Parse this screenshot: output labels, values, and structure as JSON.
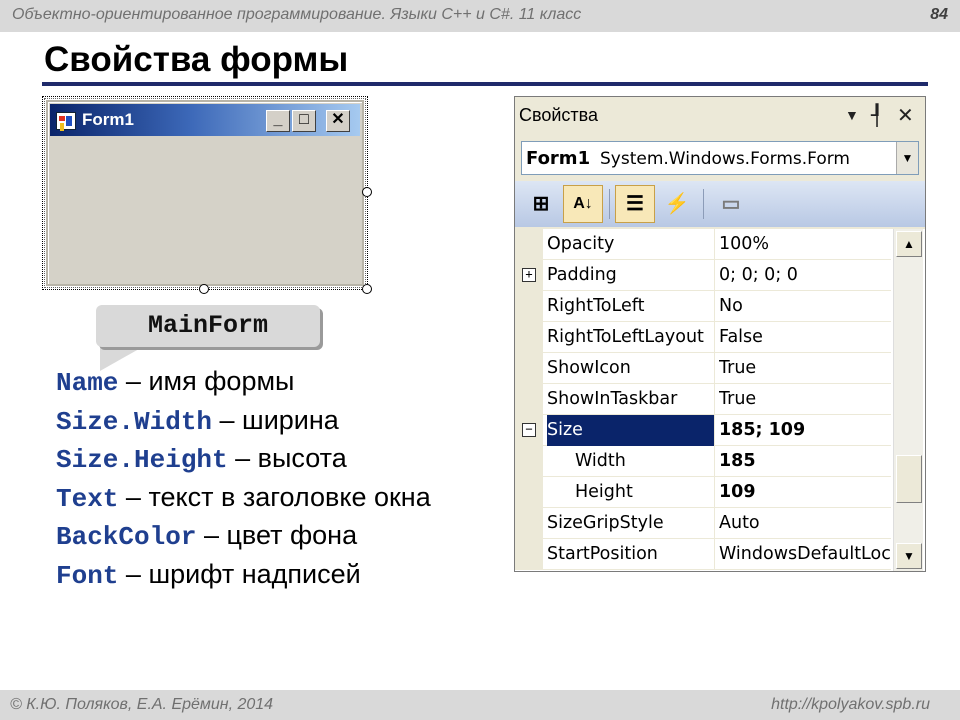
{
  "header": {
    "course": "Объектно-ориентированное программирование. Языки C++ и C#. 11 класс",
    "page_number": "84",
    "title": "Свойства формы"
  },
  "designer": {
    "form_title": "Form1",
    "min_glyph": "_",
    "max_glyph": "□",
    "close_glyph": "✕",
    "icon": "form-app-icon"
  },
  "callout": {
    "text": "MainForm"
  },
  "properties_text": [
    {
      "code": "Name",
      "desc": " – имя формы"
    },
    {
      "code": "Size.Width",
      "desc": " – ширина"
    },
    {
      "code": "Size.Height",
      "desc": " – высота"
    },
    {
      "code": "Text",
      "desc": " – текст в заголовке окна"
    },
    {
      "code": "BackColor",
      "desc": " – цвет фона"
    },
    {
      "code": "Font",
      "desc": " – шрифт надписей"
    }
  ],
  "panel": {
    "title": "Свойства",
    "dropdown_glyph": "▼",
    "pin_glyph": "┦",
    "close_glyph": "✕",
    "selector_name": "Form1",
    "selector_type": "System.Windows.Forms.Form",
    "selector_arrow": "▼",
    "toolbar": {
      "categorized": "⊞",
      "alphabetical": "A↓",
      "properties": "☰",
      "events": "⚡",
      "pages": "▭"
    },
    "rows": [
      {
        "name": "Opacity",
        "value": "100%",
        "expander": ""
      },
      {
        "name": "Padding",
        "value": "0; 0; 0; 0",
        "expander": "+"
      },
      {
        "name": "RightToLeft",
        "value": "No",
        "expander": ""
      },
      {
        "name": "RightToLeftLayout",
        "value": "False",
        "expander": ""
      },
      {
        "name": "ShowIcon",
        "value": "True",
        "expander": ""
      },
      {
        "name": "ShowInTaskbar",
        "value": "True",
        "expander": ""
      },
      {
        "name": "Size",
        "value": "185; 109",
        "expander": "−"
      },
      {
        "name": "Width",
        "value": "185",
        "expander": ""
      },
      {
        "name": "Height",
        "value": "109",
        "expander": ""
      },
      {
        "name": "SizeGripStyle",
        "value": "Auto",
        "expander": ""
      },
      {
        "name": "StartPosition",
        "value": "WindowsDefaultLocation",
        "expander": ""
      }
    ],
    "scroll_up": "▲",
    "scroll_down": "▼"
  },
  "footer": {
    "authors": "© К.Ю. Поляков, Е.А. Ерёмин, 2014",
    "url": "http://kpolyakov.spb.ru"
  }
}
